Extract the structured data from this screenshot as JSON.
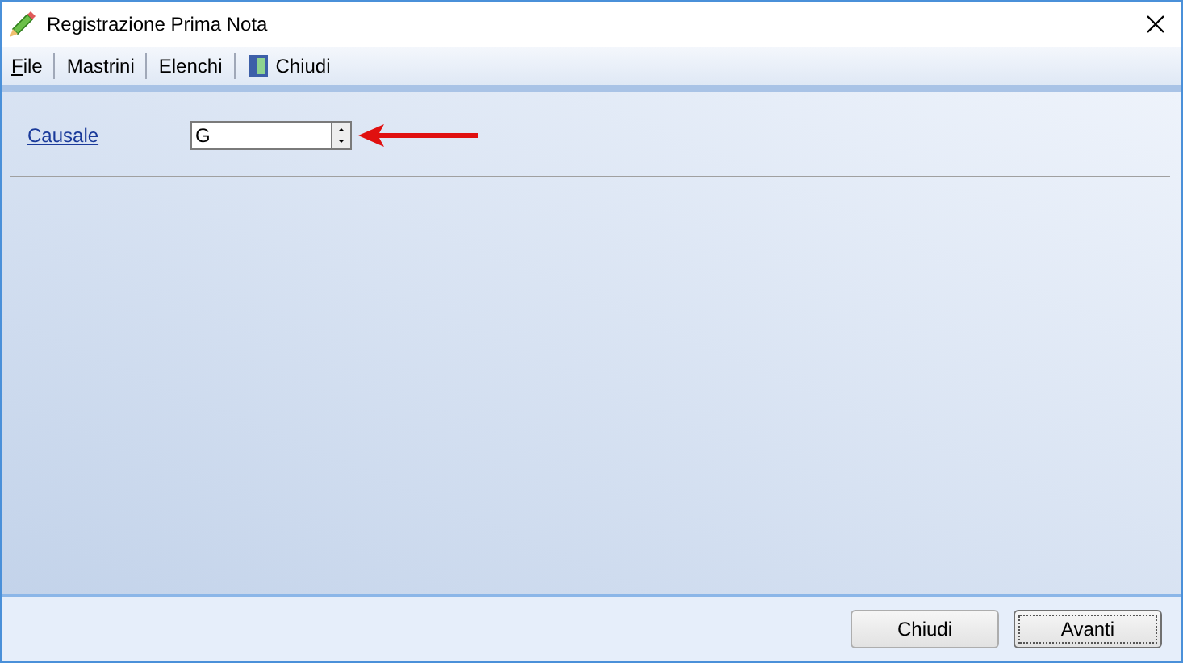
{
  "window": {
    "title": "Registrazione Prima Nota"
  },
  "menu": [
    {
      "kind": "mnemonic",
      "label": "File"
    },
    {
      "kind": "plain",
      "label": "Mastrini"
    },
    {
      "kind": "plain",
      "label": "Elenchi"
    },
    {
      "kind": "icon",
      "label": "Chiudi"
    }
  ],
  "form": {
    "label": "Causale",
    "value": "G"
  },
  "buttons": [
    {
      "label": "Chiudi",
      "selected": false
    },
    {
      "label": "Avanti",
      "selected": true
    }
  ]
}
